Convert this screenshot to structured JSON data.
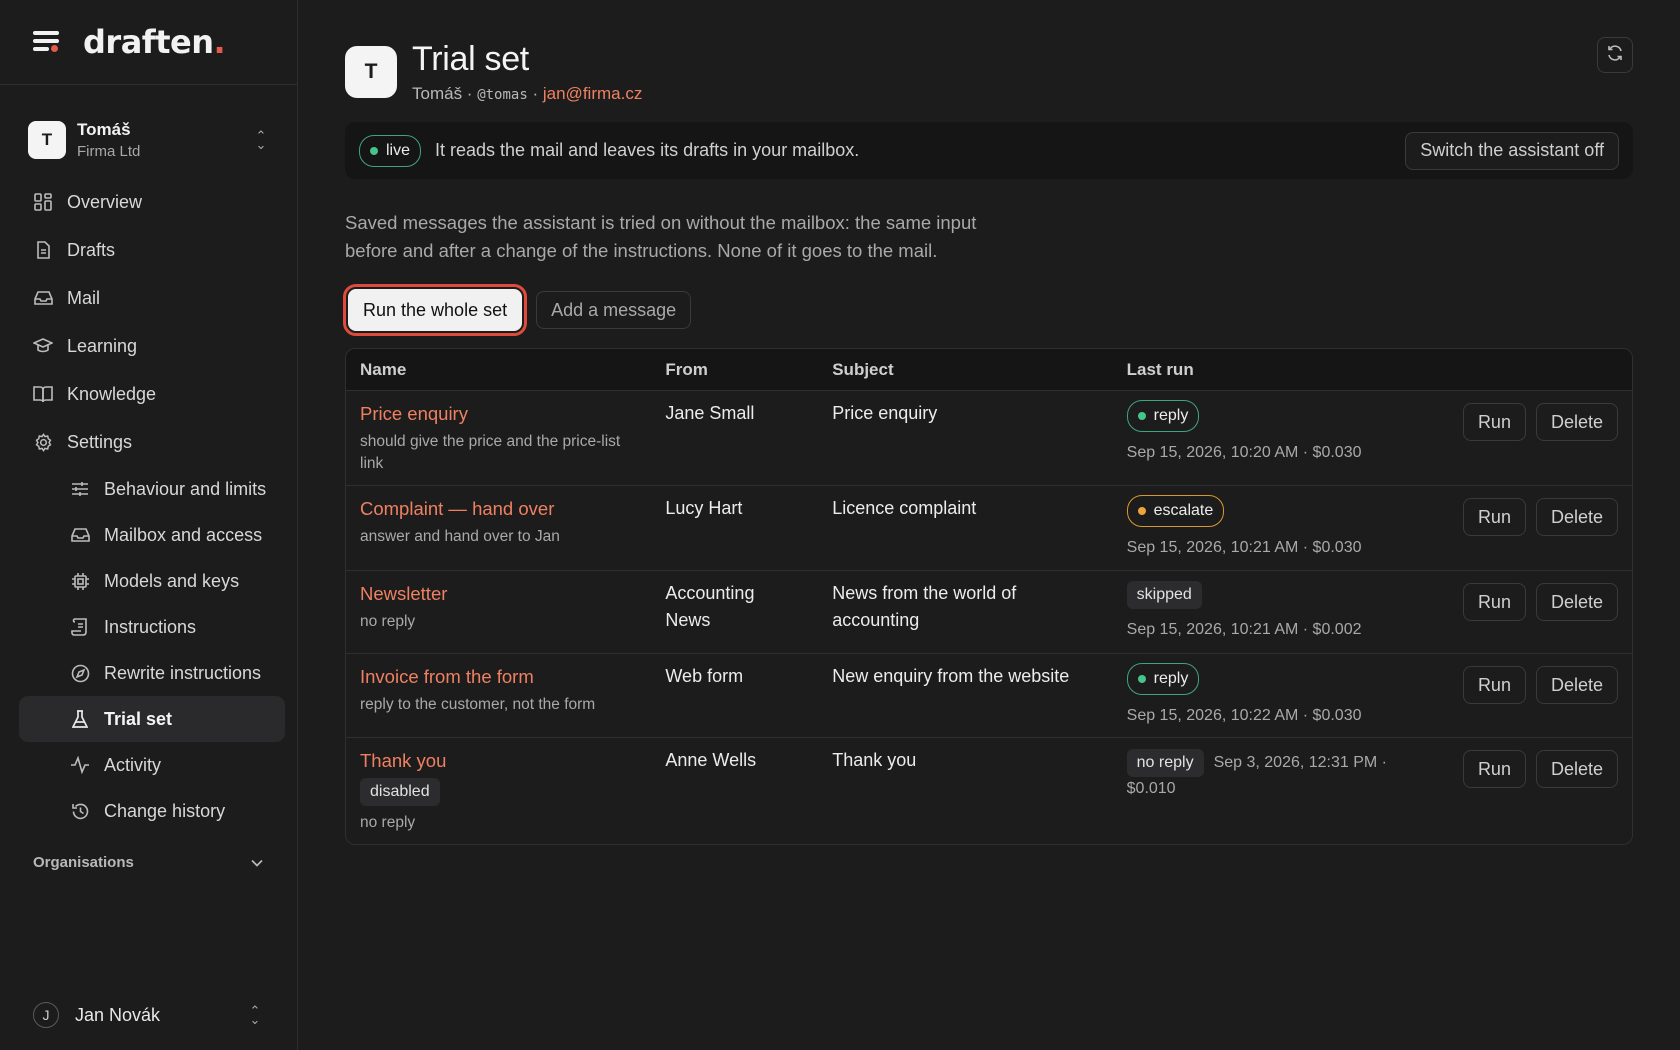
{
  "app": {
    "logo_text": "draften",
    "logo_dot": "."
  },
  "account": {
    "initial": "T",
    "name": "Tomáš",
    "org": "Firma Ltd"
  },
  "nav": [
    {
      "label": "Overview",
      "icon": "grid-icon"
    },
    {
      "label": "Drafts",
      "icon": "file-icon"
    },
    {
      "label": "Mail",
      "icon": "inbox-icon"
    },
    {
      "label": "Learning",
      "icon": "graduation-cap-icon"
    },
    {
      "label": "Knowledge",
      "icon": "book-icon"
    },
    {
      "label": "Settings",
      "icon": "gear-icon"
    }
  ],
  "subnav": [
    {
      "label": "Behaviour and limits",
      "icon": "sliders-icon"
    },
    {
      "label": "Mailbox and access",
      "icon": "inbox-icon"
    },
    {
      "label": "Models and keys",
      "icon": "chip-icon"
    },
    {
      "label": "Instructions",
      "icon": "scroll-icon"
    },
    {
      "label": "Rewrite instructions",
      "icon": "compass-icon"
    },
    {
      "label": "Trial set",
      "icon": "flask-icon",
      "active": true
    },
    {
      "label": "Activity",
      "icon": "activity-icon"
    },
    {
      "label": "Change history",
      "icon": "history-icon"
    }
  ],
  "orgs_label": "Organisations",
  "user": {
    "initial": "J",
    "name": "Jan Novák"
  },
  "page": {
    "initial": "T",
    "title": "Trial set",
    "sub_name": "Tomáš",
    "sub_sep": " · ",
    "sub_handle": "@tomas",
    "sub_mail": "jan@firma.cz"
  },
  "banner": {
    "status": "live",
    "text": "It reads the mail and leaves its drafts in your mailbox.",
    "switch_label": "Switch the assistant off"
  },
  "description": "Saved messages the assistant is tried on without the mailbox: the same input before and after a change of the instructions. None of it goes to the mail.",
  "actions": {
    "run_all": "Run the whole set",
    "add": "Add a message"
  },
  "table": {
    "headers": {
      "name": "Name",
      "from": "From",
      "subject": "Subject",
      "last_run": "Last run"
    },
    "run_label": "Run",
    "delete_label": "Delete",
    "rows": [
      {
        "name": "Price enquiry",
        "note": "should give the price and the price-list link",
        "from": "Jane Small",
        "subject": "Price enquiry",
        "result": "reply",
        "run_info": "Sep 15, 2026, 10:20 AM · $0.030"
      },
      {
        "name": "Complaint — hand over",
        "note": "answer and hand over to Jan",
        "from": "Lucy Hart",
        "subject": "Licence complaint",
        "result": "escalate",
        "run_info": "Sep 15, 2026, 10:21 AM · $0.030"
      },
      {
        "name": "Newsletter",
        "note": "no reply",
        "from": "Accounting News",
        "subject": "News from the world of accounting",
        "result": "skipped",
        "run_info": "Sep 15, 2026, 10:21 AM · $0.002"
      },
      {
        "name": "Invoice from the form",
        "note": "reply to the customer, not the form",
        "from": "Web form",
        "subject": "New enquiry from the website",
        "result": "reply",
        "run_info": "Sep 15, 2026, 10:22 AM · $0.030"
      },
      {
        "name": "Thank you",
        "tag": "disabled",
        "note": "no reply",
        "from": "Anne Wells",
        "subject": "Thank you",
        "result": "no reply",
        "run_info": "Sep 3, 2026, 12:31 PM · $0.010"
      }
    ]
  },
  "colors": {
    "accent": "#ef8062",
    "brand_dot": "#e45a4b",
    "green": "#47c489",
    "orange": "#eca43b",
    "focus": "#e04a3a"
  }
}
